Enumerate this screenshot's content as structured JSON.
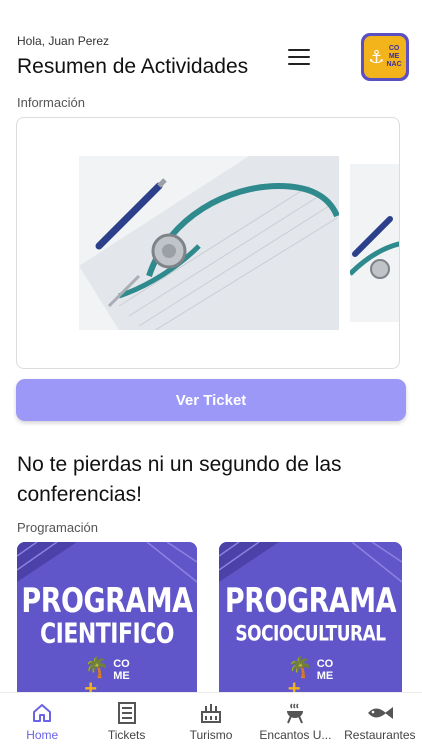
{
  "header": {
    "greeting": "Hola, Juan Perez",
    "title": "Resumen de Actividades",
    "logo_text": [
      "CO",
      "ME",
      "NAC"
    ]
  },
  "info": {
    "label": "Información",
    "button_label": "Ver Ticket"
  },
  "promo_text": "No te pierdas ni un segundo de las conferencias!",
  "programacion": {
    "label": "Programación",
    "cards": [
      {
        "line1": "PROGRAMA",
        "line2": "CIENTIFICO",
        "logo_text": [
          "CO",
          "ME"
        ]
      },
      {
        "line1": "PROGRAMA",
        "line2": "SOCIOCULTURAL",
        "logo_text": [
          "CO",
          "ME"
        ]
      }
    ]
  },
  "bottom_nav": {
    "active_color": "#6a63e8",
    "items": [
      {
        "label": "Home",
        "icon": "home-icon"
      },
      {
        "label": "Tickets",
        "icon": "ticket-icon"
      },
      {
        "label": "Turismo",
        "icon": "tourism-icon"
      },
      {
        "label": "Encantos U...",
        "icon": "grill-icon"
      },
      {
        "label": "Restaurantes",
        "icon": "fish-icon"
      }
    ]
  },
  "colors": {
    "accent": "#9c98f8",
    "brand_purple": "#5b4fc4",
    "brand_yellow": "#f3b31b"
  }
}
